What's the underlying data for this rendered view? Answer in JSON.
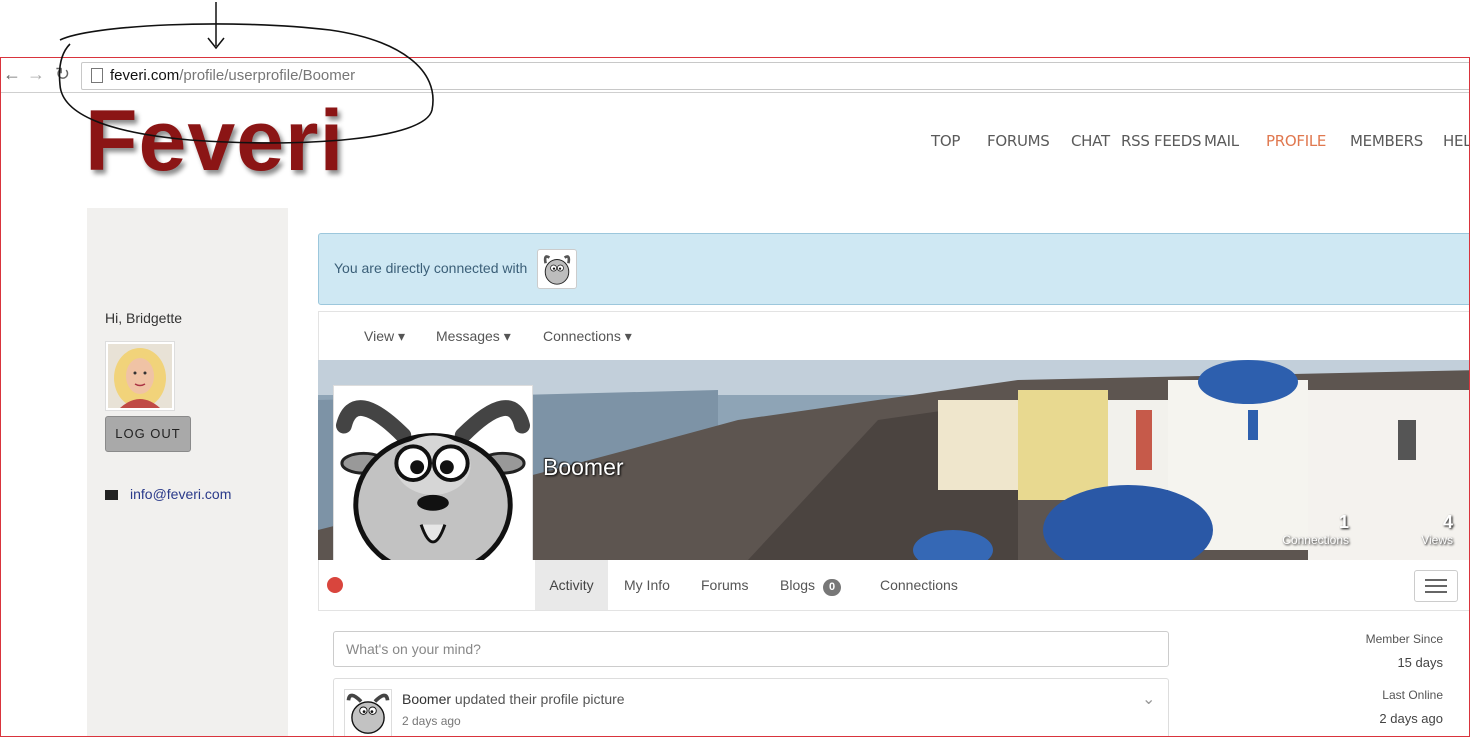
{
  "browser": {
    "url_host": "feveri.com",
    "url_path": "/profile/userprofile/Boomer",
    "back_icon": "back-arrow-icon",
    "forward_icon": "forward-arrow-icon",
    "reload_icon": "reload-icon"
  },
  "site": {
    "logo": "Feveri",
    "logo_color": "#8b1515",
    "accent_color": "#e0784f",
    "nav": [
      {
        "label": "TOP"
      },
      {
        "label": "FORUMS"
      },
      {
        "label": "CHAT"
      },
      {
        "label": "RSS FEEDS"
      },
      {
        "label": "MAIL"
      },
      {
        "label": "PROFILE"
      },
      {
        "label": "MEMBERS"
      },
      {
        "label": "HELP"
      }
    ]
  },
  "sidebar": {
    "greeting": "Hi, Bridgette",
    "logout_label": "LOG OUT",
    "email": "info@feveri.com"
  },
  "banner": {
    "text": "You are directly connected with"
  },
  "profile_menu": {
    "view": "View",
    "messages": "Messages",
    "connections": "Connections"
  },
  "profile": {
    "name": "Boomer",
    "stats": {
      "connections_count": "1",
      "connections_label": "Connections",
      "views_count": "4",
      "views_label": "Views"
    },
    "status_color": "#d9453d"
  },
  "tabs": [
    {
      "label": "Activity",
      "active": true
    },
    {
      "label": "My Info"
    },
    {
      "label": "Forums"
    },
    {
      "label": "Blogs",
      "badge": "0"
    },
    {
      "label": "Connections"
    }
  ],
  "activity": {
    "placeholder": "What's on your mind?",
    "feed": [
      {
        "user": "Boomer",
        "action": "updated their profile picture",
        "time": "2 days ago"
      }
    ]
  },
  "member_meta": {
    "since_label": "Member Since",
    "since_value": "15 days",
    "online_label": "Last Online",
    "online_value": "2 days ago"
  }
}
